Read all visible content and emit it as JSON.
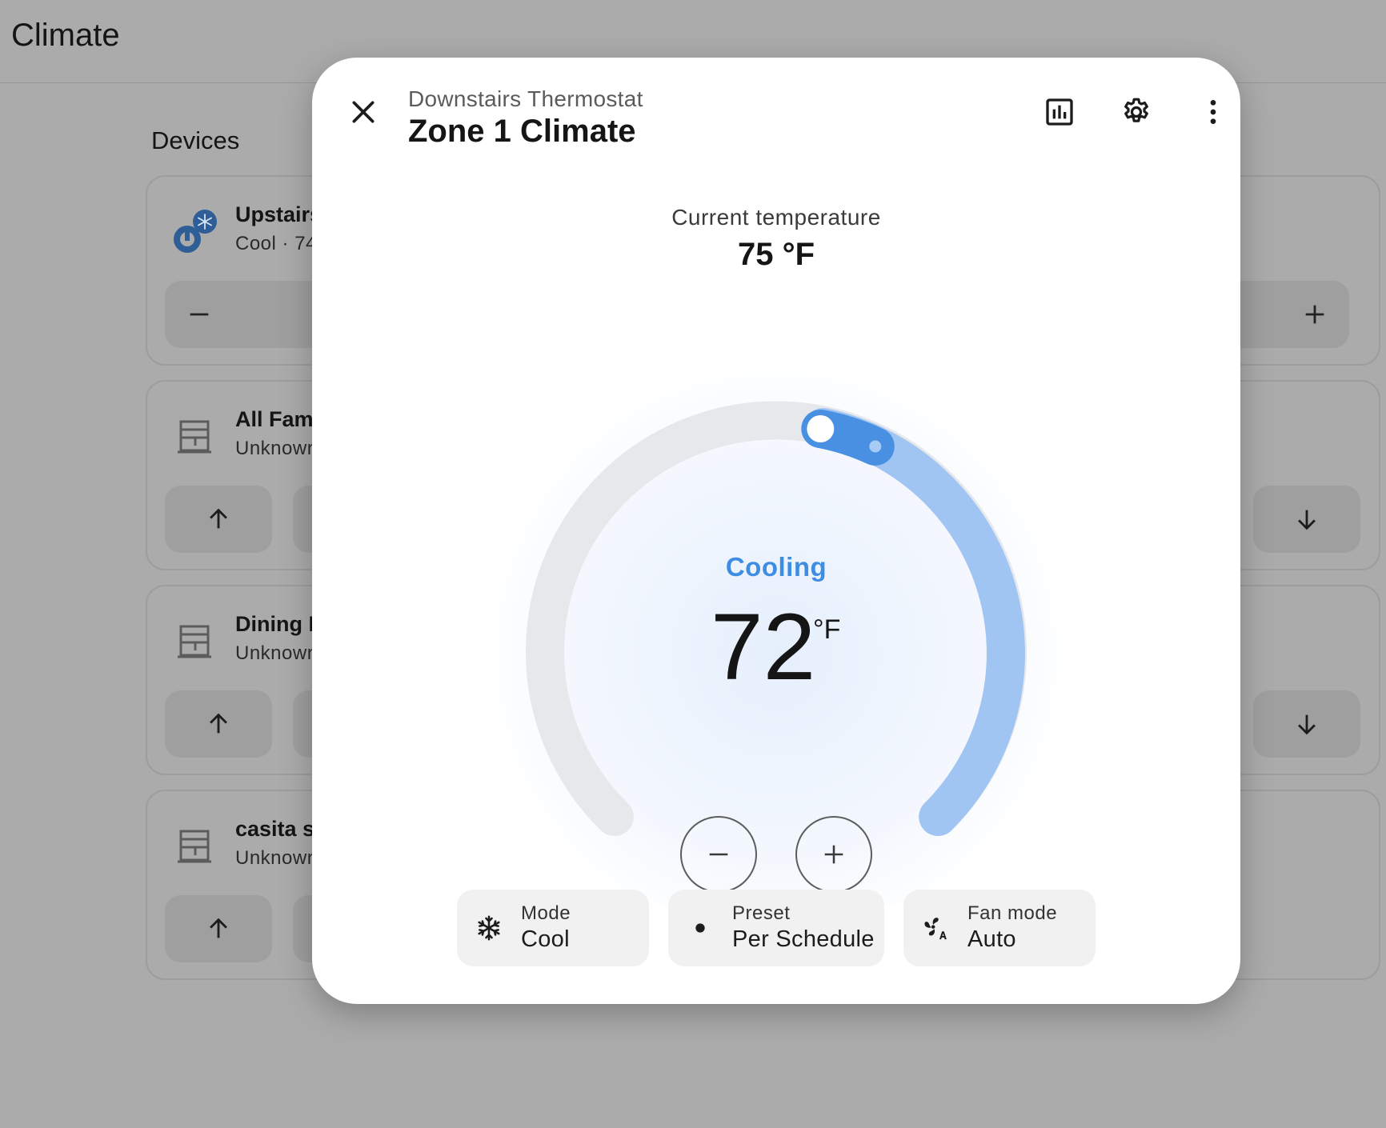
{
  "page": {
    "title": "Climate"
  },
  "devices_section": {
    "title": "Devices",
    "cards": [
      {
        "name": "Upstairs",
        "state": "Cool · 74",
        "icon": "thermostat-snowflake-icon"
      },
      {
        "name": "All Fam",
        "state": "Unknown",
        "icon": "window-shutter-icon"
      },
      {
        "name": "Dining F",
        "state": "Unknown",
        "icon": "window-shutter-icon"
      },
      {
        "name": "casita s",
        "state": "Unknown",
        "icon": "window-shutter-icon"
      }
    ]
  },
  "dialog": {
    "subtitle": "Downstairs Thermostat",
    "title": "Zone 1 Climate",
    "actions": [
      "close-icon",
      "history-chart-icon",
      "settings-gear-icon",
      "more-vertical-icon"
    ],
    "current_temp_label": "Current temperature",
    "current_temp_value": "75 °F",
    "status": "Cooling",
    "target_temp": "72",
    "target_unit": "°F",
    "colors": {
      "accent": "#3f8de3",
      "track": "#e6e8ec",
      "active_arc": "#a1c5f3",
      "handle": "#4a90e2"
    },
    "chips": [
      {
        "label": "Mode",
        "value": "Cool",
        "icon": "snowflake-icon"
      },
      {
        "label": "Preset",
        "value": "Per Schedule",
        "icon": "dot-icon"
      },
      {
        "label": "Fan mode",
        "value": "Auto",
        "icon": "fan-auto-icon"
      }
    ]
  }
}
